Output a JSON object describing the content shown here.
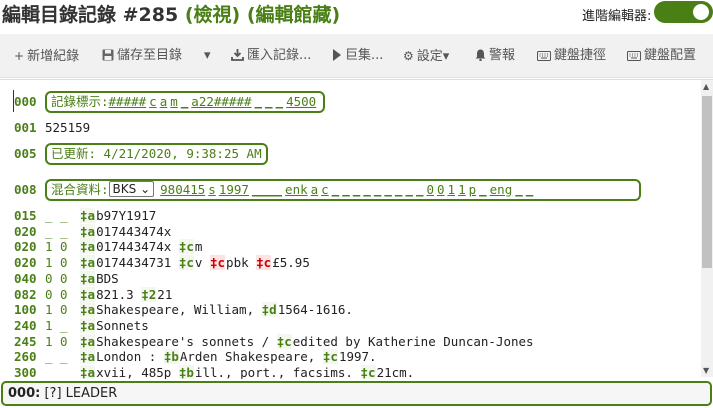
{
  "header": {
    "title": "編輯目錄記錄 #285",
    "view_status": "(檢視)",
    "library": "(編輯館藏)",
    "advanced_editor_label": "進階編輯器:",
    "advanced_editor_on": true
  },
  "toolbar": {
    "new_record": "新增紀錄",
    "save_to_catalog": "儲存至目錄",
    "import_record": "匯入記錄...",
    "macros": "巨集...",
    "settings": "設定",
    "alerts": "警報",
    "keyboard_shortcuts": "鍵盤捷徑",
    "keyboard_layout": "鍵盤配置"
  },
  "fields": {
    "leader": {
      "tag": "000",
      "label": "記錄標示:",
      "positions": [
        "#####",
        "c",
        "a",
        "m",
        "_",
        "a22#####",
        "_",
        "_",
        "_",
        "4500"
      ]
    },
    "f001": {
      "tag": "001",
      "value": "525159"
    },
    "f005": {
      "tag": "005",
      "label": "已更新: 4/21/2020, 9:38:25 AM"
    },
    "f008": {
      "tag": "008",
      "label": "混合資料:",
      "material_type": "BKS",
      "material_options": [
        "BKS"
      ],
      "positions": [
        "980415",
        "s",
        "1997",
        "____",
        "enk",
        "a",
        "c",
        "_",
        "_",
        "_",
        "_",
        "_",
        "_",
        "_",
        "_",
        "_",
        "0",
        "0",
        "1",
        "1",
        "p",
        "_",
        "eng",
        "_",
        "_"
      ]
    },
    "rows": [
      {
        "tag": "015",
        "ind": "_ _",
        "subs": [
          {
            "code": "‡a",
            "text": "b97Y1917"
          }
        ]
      },
      {
        "tag": "020",
        "ind": "_ _",
        "subs": [
          {
            "code": "‡a",
            "text": "017443474x"
          }
        ]
      },
      {
        "tag": "020",
        "ind": "1 0",
        "subs": [
          {
            "code": "‡a",
            "text": "017443474x"
          },
          {
            "code": "‡c",
            "text": "m"
          }
        ]
      },
      {
        "tag": "020",
        "ind": "1 0",
        "subs": [
          {
            "code": "‡a",
            "text": "0174434731"
          },
          {
            "code": "‡c",
            "text": "v"
          },
          {
            "code": "‡c",
            "text": "pbk",
            "bad": true
          },
          {
            "code": "‡c",
            "text": "£5.95",
            "bad": true
          }
        ]
      },
      {
        "tag": "040",
        "ind": "0 0",
        "subs": [
          {
            "code": "‡a",
            "text": "BDS"
          }
        ]
      },
      {
        "tag": "082",
        "ind": "0 0",
        "subs": [
          {
            "code": "‡a",
            "text": "821.3"
          },
          {
            "code": "‡2",
            "text": "21"
          }
        ]
      },
      {
        "tag": "100",
        "ind": "1 0",
        "subs": [
          {
            "code": "‡a",
            "text": "Shakespeare, William,"
          },
          {
            "code": "‡d",
            "text": "1564-1616."
          }
        ]
      },
      {
        "tag": "240",
        "ind": "1 _",
        "subs": [
          {
            "code": "‡a",
            "text": "Sonnets"
          }
        ]
      },
      {
        "tag": "245",
        "ind": "1 0",
        "subs": [
          {
            "code": "‡a",
            "text": "Shakespeare's sonnets /"
          },
          {
            "code": "‡c",
            "text": "edited by Katherine Duncan-Jones"
          }
        ]
      },
      {
        "tag": "260",
        "ind": "_ _",
        "subs": [
          {
            "code": "‡a",
            "text": "London :"
          },
          {
            "code": "‡b",
            "text": "Arden Shakespeare,"
          },
          {
            "code": "‡c",
            "text": "1997."
          }
        ]
      },
      {
        "tag": "300",
        "ind": "_ _",
        "subs": [
          {
            "code": "‡a",
            "text": "xvii, 485p"
          },
          {
            "code": "‡b",
            "text": "ill., port., facsims."
          },
          {
            "code": "‡c",
            "text": "21cm."
          }
        ]
      }
    ]
  },
  "statusbar": {
    "tag": "000:",
    "help": "[?]",
    "label": "LEADER"
  },
  "colors": {
    "accent": "#4a7f16",
    "error": "#c00000"
  }
}
